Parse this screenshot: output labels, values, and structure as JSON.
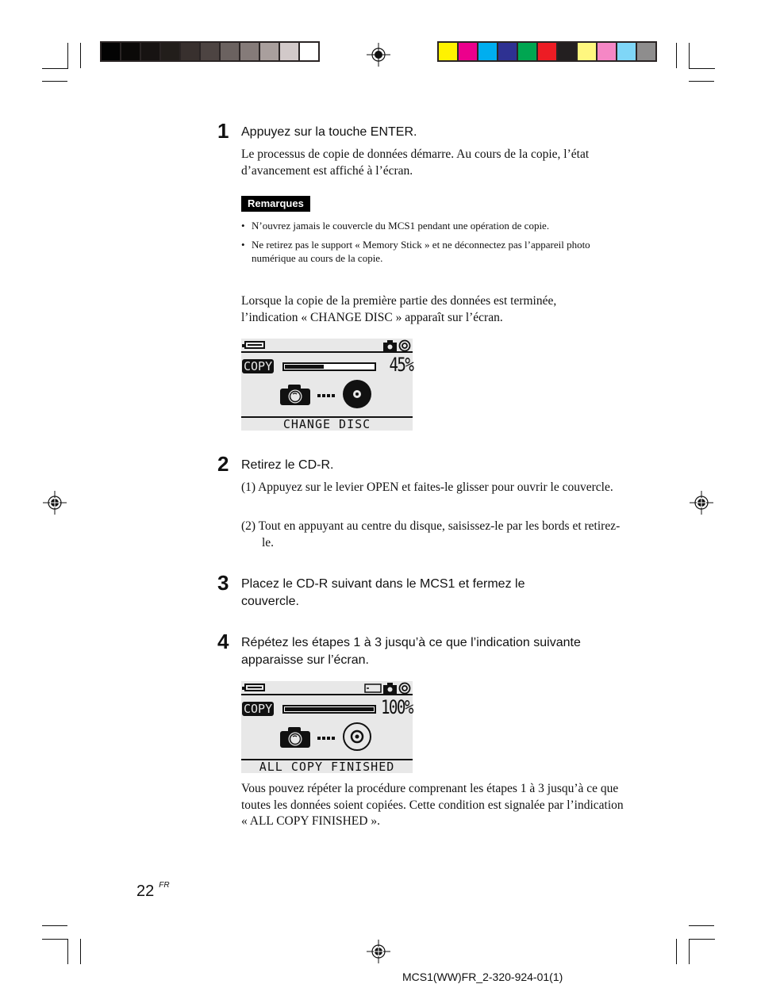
{
  "color_bars": {
    "grayscale": [
      "#030303",
      "#0b0908",
      "#171312",
      "#221e1b",
      "#38302e",
      "#4d4442",
      "#6b6260",
      "#857b79",
      "#a99f9d",
      "#d2c9c9",
      "#ffffff"
    ],
    "process": [
      "#fff200",
      "#ec008c",
      "#00aeef",
      "#2e3192",
      "#00a651",
      "#ed1c24",
      "#231f20",
      "#fff77f",
      "#f587c5",
      "#7fd6f7",
      "#8e8d8d"
    ]
  },
  "step1": {
    "number": "1",
    "title": "Appuyez sur la touche ENTER.",
    "body": "Le processus de copie de données démarre. Au cours de la copie, l’état d’avancement est affiché à l’écran.",
    "remarks_label": "Remarques",
    "remarks": [
      "N’ouvrez jamais le couvercle du MCS1 pendant une opération de copie.",
      "Ne retirez pas le support « Memory Stick » et ne déconnectez pas l’appareil photo numérique au cours de la copie."
    ],
    "bullet": "•",
    "after": "Lorsque la copie de la première partie des données est terminée, l’indication « CHANGE DISC » apparaît sur l’écran."
  },
  "lcd1": {
    "label": "COPY",
    "progress": 0.45,
    "percent_text": "45%",
    "status": "CHANGE DISC",
    "icons": [
      "battery-icon",
      "camera-icon",
      "disc-icon",
      "camera-body-icon",
      "transfer-dots-icon",
      "disc-full-icon"
    ]
  },
  "step2": {
    "number": "2",
    "title": "Retirez le CD-R.",
    "items": [
      "(1) Appuyez sur le levier OPEN et faites-le glisser pour ouvrir le couvercle.",
      "(2) Tout en appuyant au centre du disque, saisissez-le par les bords et retirez-le."
    ]
  },
  "step3": {
    "number": "3",
    "title": "Placez le CD-R suivant dans le MCS1 et fermez le couvercle."
  },
  "step4": {
    "number": "4",
    "title": "Répétez les étapes 1 à 3 jusqu’à ce que l’indication suivante apparaisse sur l’écran.",
    "after": "Vous pouvez répéter la procédure comprenant les étapes 1 à 3 jusqu’à ce que toutes les données soient copiées. Cette condition est signalée par l’indication « ALL COPY FINISHED »."
  },
  "lcd2": {
    "label": "COPY",
    "progress": 1.0,
    "percent_text": "100%",
    "status": "ALL COPY FINISHED",
    "icons": [
      "battery-icon",
      "memory-stick-icon",
      "camera-icon",
      "disc-icon",
      "camera-body-icon",
      "transfer-dots-icon",
      "disc-outline-icon"
    ]
  },
  "footer": {
    "page_number": "22",
    "language": "FR",
    "doc_id": "MCS1(WW)FR_2-320-924-01(1)"
  }
}
